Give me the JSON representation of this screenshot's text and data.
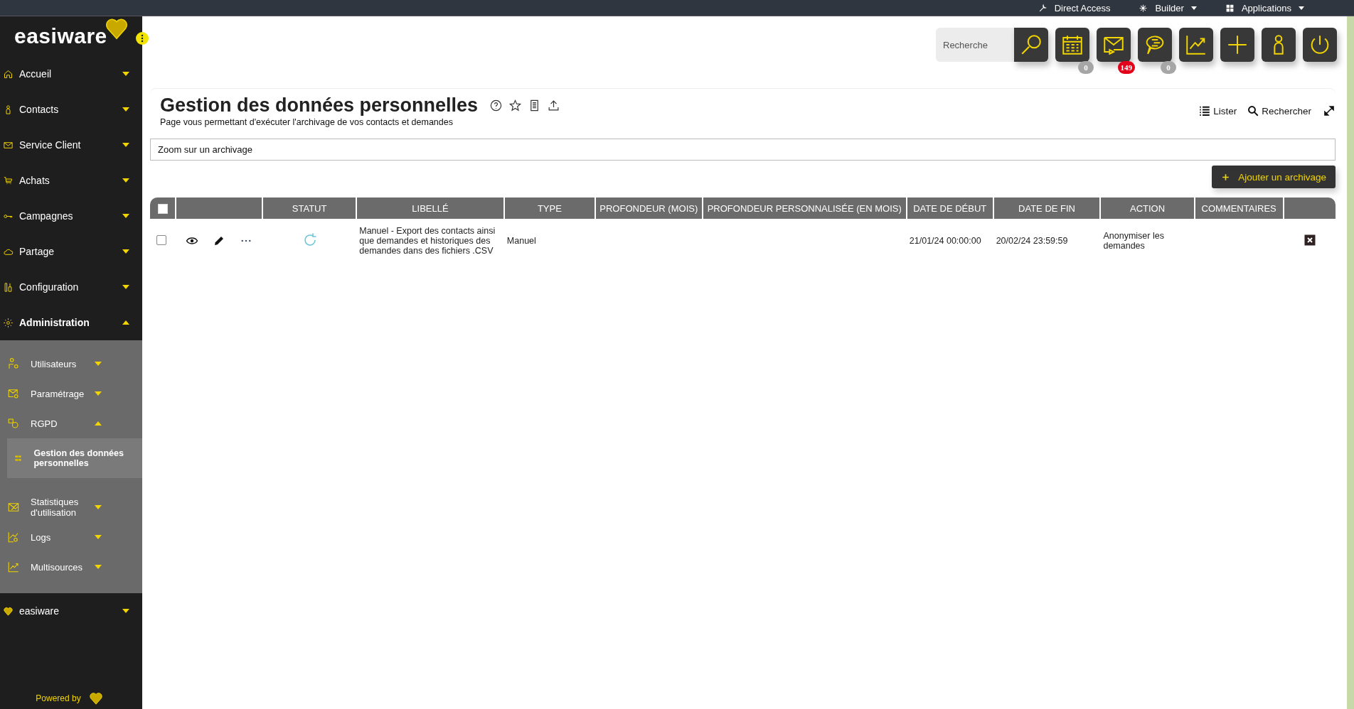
{
  "top_bar": {
    "links": [
      {
        "label": "Direct Access",
        "caret": false
      },
      {
        "label": "Builder",
        "caret": true
      },
      {
        "label": "Applications",
        "caret": true
      }
    ]
  },
  "sidebar": {
    "logo": "easiware",
    "items": [
      {
        "label": "Accueil",
        "expanded": false
      },
      {
        "label": "Contacts",
        "expanded": false
      },
      {
        "label": "Service Client",
        "expanded": false
      },
      {
        "label": "Achats",
        "expanded": false
      },
      {
        "label": "Campagnes",
        "expanded": false
      },
      {
        "label": "Partage",
        "expanded": false
      },
      {
        "label": "Configuration",
        "expanded": false
      },
      {
        "label": "Administration",
        "expanded": true,
        "children": [
          {
            "label": "Utilisateurs",
            "expanded": false
          },
          {
            "label": "Paramétrage",
            "expanded": false
          },
          {
            "label": "RGPD",
            "expanded": true,
            "children": [
              {
                "label": "Gestion des données personnelles",
                "selected": true
              }
            ]
          },
          {
            "label": "Statistiques d'utilisation",
            "expanded": false
          },
          {
            "label": "Logs",
            "expanded": false
          },
          {
            "label": "Multisources",
            "expanded": false
          }
        ]
      },
      {
        "label": "easiware",
        "expanded": false
      }
    ],
    "footer": "Powered by"
  },
  "header": {
    "search": {
      "placeholder": "Recherche"
    },
    "buttons": [
      {
        "kind": "search"
      },
      {
        "kind": "calendar",
        "badge": {
          "text": "0",
          "color": "#a6a6a6"
        }
      },
      {
        "kind": "mail",
        "badge": {
          "text": "149",
          "color": "#e3001b"
        }
      },
      {
        "kind": "chat",
        "badge": {
          "text": "0",
          "color": "#a6a6a6"
        }
      },
      {
        "kind": "chart"
      },
      {
        "kind": "plus"
      },
      {
        "kind": "person"
      },
      {
        "kind": "power"
      }
    ]
  },
  "page": {
    "title": "Gestion des données personnelles",
    "subtitle": "Page vous permettant d'exécuter l'archivage de vos contacts et demandes",
    "tools": [
      "Lister",
      "Rechercher"
    ],
    "zoom_panel": {
      "title": "Zoom sur un archivage"
    },
    "add_button": "Ajouter un archivage"
  },
  "table": {
    "select_all": {
      "checked": false
    },
    "columns": [
      "STATUT",
      "LIBELLÉ",
      "TYPE",
      "PROFONDEUR (MOIS)",
      "PROFONDEUR PERSONNALISÉE (EN MOIS)",
      "DATE DE DÉBUT",
      "DATE DE FIN",
      "ACTION",
      "COMMENTAIRES"
    ],
    "rows": [
      {
        "checked": false,
        "cells": [
          null,
          "Manuel - Export des contacts ainsi que demandes et historiques des demandes dans des fichiers .CSV",
          "Manuel",
          null,
          null,
          "21/01/24 00:00:00",
          "20/02/24 23:59:59",
          "Anonymiser les demandes",
          null
        ]
      }
    ]
  }
}
